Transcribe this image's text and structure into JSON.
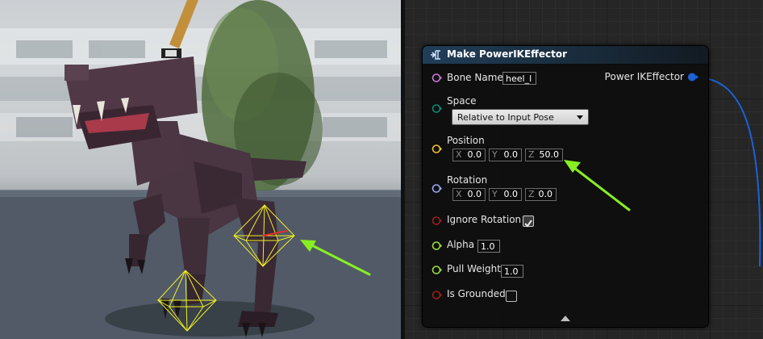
{
  "node": {
    "title": "Make PowerIKEffector",
    "output": {
      "label": "Power IKEffector"
    },
    "pins": {
      "bone_name": {
        "label": "Bone Name",
        "value": "heel_l"
      },
      "space": {
        "label": "Space",
        "value": "Relative to Input Pose"
      },
      "position": {
        "label": "Position",
        "x_axis": "X",
        "x": "0.0",
        "y_axis": "Y",
        "y": "0.0",
        "z_axis": "Z",
        "z": "50.0"
      },
      "rotation": {
        "label": "Rotation",
        "x_axis": "X",
        "x": "0.0",
        "y_axis": "Y",
        "y": "0.0",
        "z_axis": "Z",
        "z": "0.0"
      },
      "ignore_rotation": {
        "label": "Ignore Rotation",
        "checked": true
      },
      "alpha": {
        "label": "Alpha",
        "value": "1.0"
      },
      "pull_weight": {
        "label": "Pull Weight",
        "value": "1.0"
      },
      "is_grounded": {
        "label": "Is Grounded",
        "checked": false
      }
    }
  },
  "colors": {
    "name_pin": "#c77ad6",
    "enum_pin": "#0e8c78",
    "vector_pin": "#f2c230",
    "rotator_pin": "#9aa9f2",
    "bool_pin": "#9a1e1e",
    "float_pin": "#9cdc3a",
    "struct_pin": "#1a62d6",
    "wire": "#1a62d6",
    "annotation_arrow": "#88ee22",
    "effector_gizmo": "#f0f020"
  },
  "icons": {
    "node": "function-icon",
    "collapse": "collapse-arrow-icon",
    "checkbox_checked": "checkmark-icon"
  }
}
